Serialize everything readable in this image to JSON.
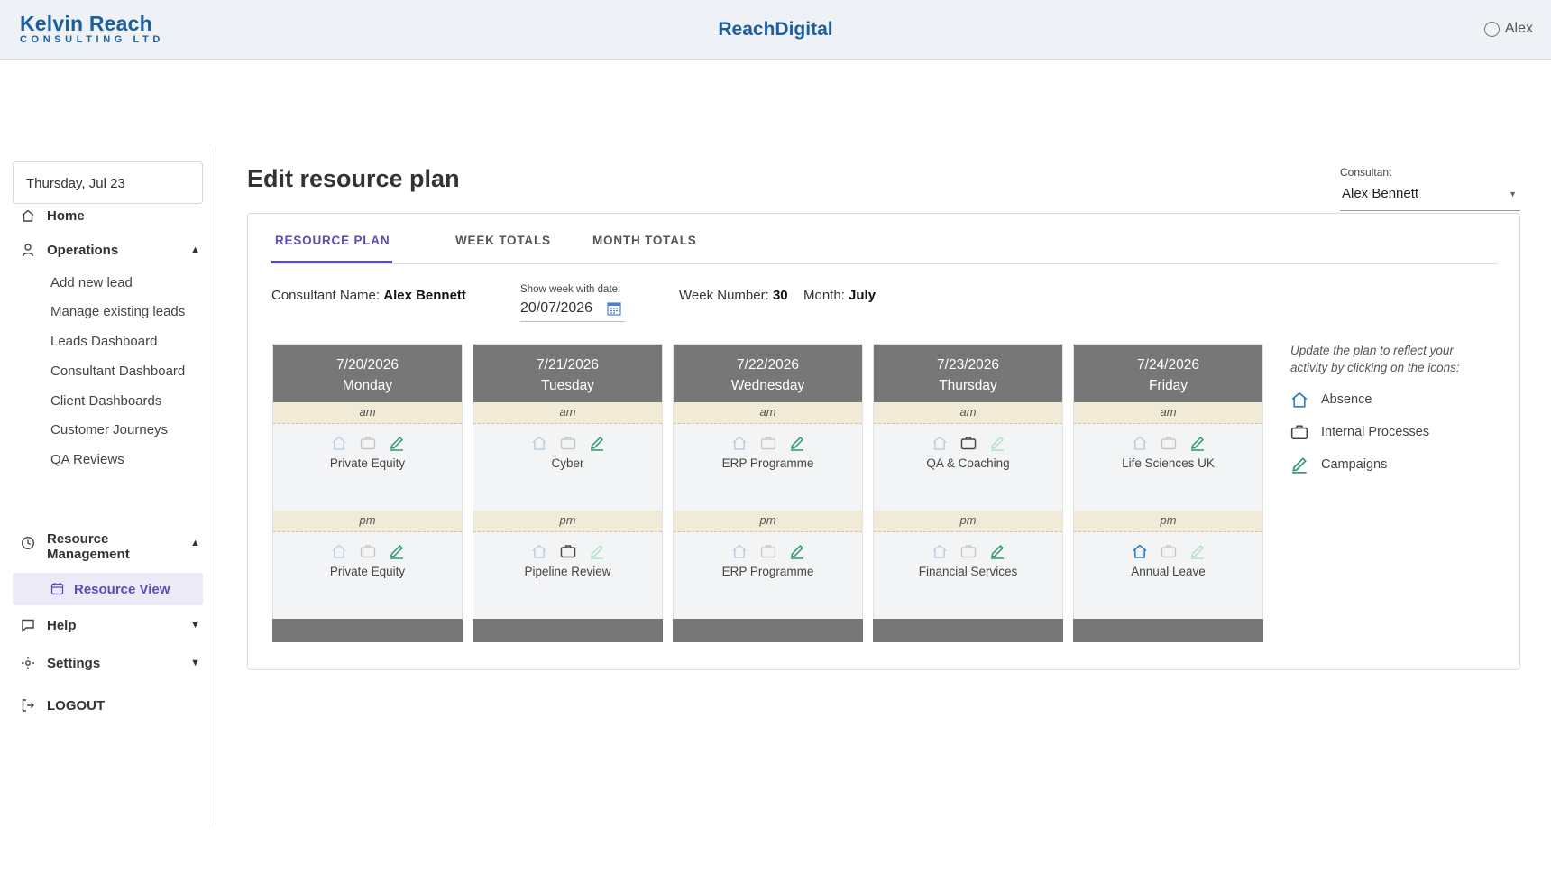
{
  "header": {
    "logo_main": "Kelvin Reach",
    "logo_sub": "CONSULTING LTD",
    "brand": "ReachDigital",
    "user": "Alex"
  },
  "sidebar": {
    "date": "Thursday, Jul 23",
    "home": "Home",
    "operations": "Operations",
    "operations_items": [
      "Add new lead",
      "Manage existing leads",
      "Leads Dashboard",
      "Consultant Dashboard",
      "Client Dashboards",
      "Customer Journeys",
      "QA Reviews"
    ],
    "resource_management": "Resource Management",
    "resource_view": "Resource View",
    "help": "Help",
    "settings": "Settings",
    "logout": "LOGOUT"
  },
  "main": {
    "title": "Edit resource plan",
    "consultant_label": "Consultant",
    "consultant_value": "Alex Bennett",
    "tabs": [
      "RESOURCE PLAN",
      "WEEK TOTALS",
      "MONTH TOTALS"
    ],
    "consultant_name_label": "Consultant Name:",
    "consultant_name": "Alex Bennett",
    "show_week_label": "Show week with date:",
    "show_week_value": "20/07/2026",
    "week_number_label": "Week Number:",
    "week_number": "30",
    "month_label": "Month:",
    "month": "July",
    "am_label": "am",
    "pm_label": "pm",
    "days": [
      {
        "date": "7/20/2026",
        "name": "Monday",
        "am": "Private Equity",
        "pm": "Private Equity"
      },
      {
        "date": "7/21/2026",
        "name": "Tuesday",
        "am": "Cyber",
        "pm": "Pipeline Review"
      },
      {
        "date": "7/22/2026",
        "name": "Wednesday",
        "am": "ERP Programme",
        "pm": "ERP Programme"
      },
      {
        "date": "7/23/2026",
        "name": "Thursday",
        "am": "QA & Coaching",
        "pm": "Financial Services"
      },
      {
        "date": "7/24/2026",
        "name": "Friday",
        "am": "Life Sciences UK",
        "pm": "Annual Leave"
      }
    ],
    "legend": {
      "hint": "Update the plan to reflect your activity by clicking on the icons:",
      "absence": "Absence",
      "internal": "Internal Processes",
      "campaigns": "Campaigns"
    }
  },
  "colors": {
    "brand": "#1d5f9e",
    "accent": "#5b4db5",
    "day_header": "#777777",
    "slot_label_bg": "#f1ead6",
    "campaign_green": "#2a9d6a",
    "absence_blue": "#2f7fc1"
  }
}
